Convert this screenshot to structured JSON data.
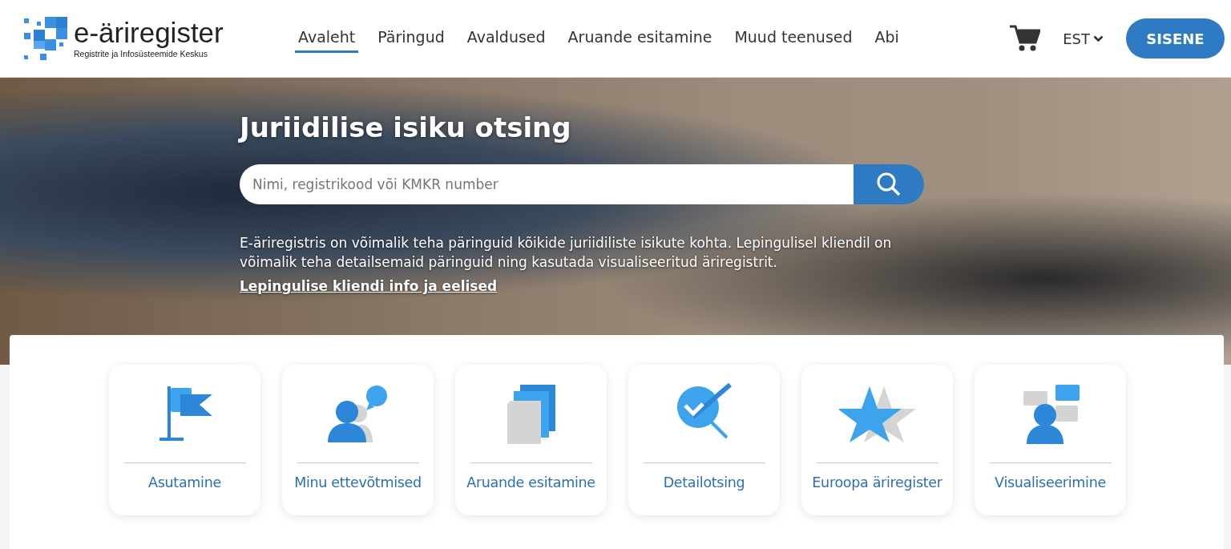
{
  "logo": {
    "name": "e-äriregister",
    "subtitle": "Registrite ja Infosüsteemide Keskus"
  },
  "nav": [
    {
      "label": "Avaleht",
      "selected": true
    },
    {
      "label": "Päringud",
      "selected": false
    },
    {
      "label": "Avaldused",
      "selected": false
    },
    {
      "label": "Aruande esitamine",
      "selected": false
    },
    {
      "label": "Muud teenused",
      "selected": false
    },
    {
      "label": "Abi",
      "selected": false
    }
  ],
  "language": "EST",
  "login_button": "SISENE",
  "hero": {
    "title": "Juriidilise isiku otsing",
    "search": {
      "placeholder": "Nimi, registrikood või KMKR number"
    },
    "description": "E-äriregistris on võimalik teha päringuid kõikide juriidiliste isikute kohta. Lepingulisel kliendil on võimalik teha detailsemaid päringuid ning kasutada visualiseeritud äriregistrit.",
    "link": "Lepingulise kliendi info ja eelised"
  },
  "tiles": [
    {
      "kind": "flag",
      "label": "Asutamine"
    },
    {
      "kind": "people",
      "label": "Minu ettevõtmised"
    },
    {
      "kind": "documents",
      "label": "Aruande esitamine"
    },
    {
      "kind": "search",
      "label": "Detailotsing"
    },
    {
      "kind": "stars",
      "label": "Euroopa äriregister"
    },
    {
      "kind": "visual",
      "label": "Visualiseerimine"
    }
  ]
}
